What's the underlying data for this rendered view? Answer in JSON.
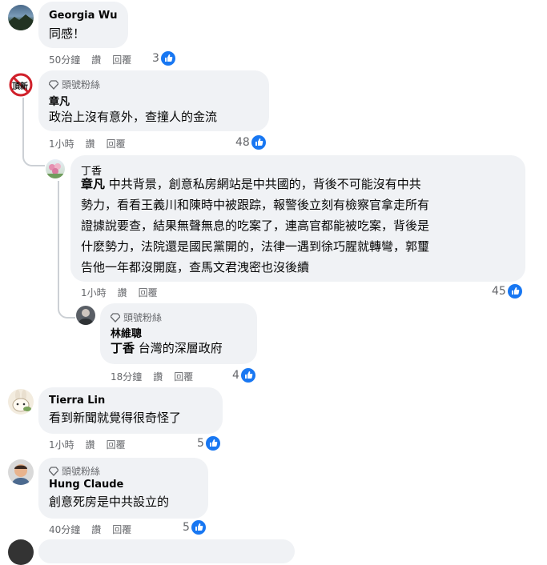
{
  "comments": [
    {
      "id": "c1",
      "name": "Georgia Wu",
      "text": "同感！",
      "time": "50分鐘",
      "like_label": "讚",
      "reply_label": "回覆",
      "reactions": "3"
    },
    {
      "id": "c2",
      "badge": "頭號粉絲",
      "name": "章凡",
      "text": "政治上沒有意外，查撞人的金流",
      "time": "1小時",
      "like_label": "讚",
      "reply_label": "回覆",
      "reactions": "48"
    },
    {
      "id": "c3",
      "name": "丁香",
      "mention": "章凡",
      "lines": [
        "中共背景，創意私房網站是中共國的，背後不可能沒有中共",
        "勢力，看看王義川和陳時中被跟踪，報警後立刻有檢察官拿走所有",
        "證據說要查，結果無聲無息的吃案了，連高官都能被吃案，背後是",
        "什麽勢力，法院還是國民黨開的，法律一遇到徐巧腥就轉彎，郭璽",
        "告他一年都沒開庭，查馬文君洩密也沒後續"
      ],
      "time": "1小時",
      "like_label": "讚",
      "reply_label": "回覆",
      "reactions": "45"
    },
    {
      "id": "c4",
      "badge": "頭號粉絲",
      "name": "林維聰",
      "mention": "丁香",
      "text": "台灣的深層政府",
      "time": "18分鐘",
      "like_label": "讚",
      "reply_label": "回覆",
      "reactions": "4"
    },
    {
      "id": "c5",
      "name": "Tierra Lin",
      "text": "看到新聞就覺得很奇怪了",
      "time": "1小時",
      "like_label": "讚",
      "reply_label": "回覆",
      "reactions": "5"
    },
    {
      "id": "c6",
      "badge": "頭號粉絲",
      "name": "Hung Claude",
      "text": "創意死房是中共設立的",
      "time": "40分鐘",
      "like_label": "讚",
      "reply_label": "回覆",
      "reactions": "5"
    }
  ],
  "avatar_icons": {
    "no_sign_text": "頂新"
  },
  "colors": {
    "accent": "#1877f2",
    "bubble": "#f0f2f5",
    "meta": "#65676b"
  }
}
